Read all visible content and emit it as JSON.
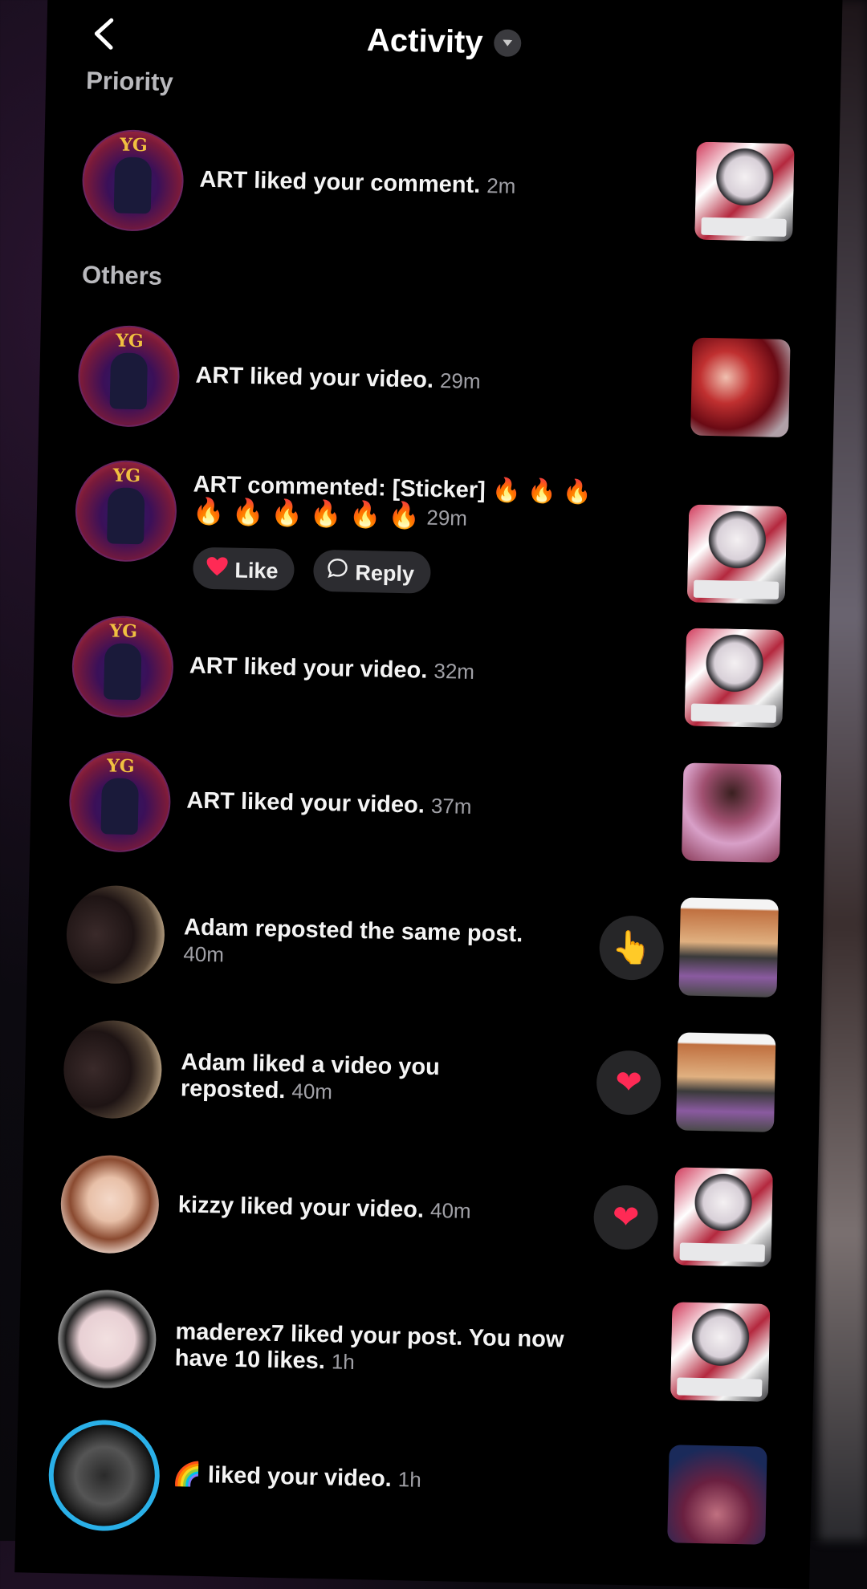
{
  "header": {
    "title": "Activity"
  },
  "sections": {
    "priority": "Priority",
    "others": "Others"
  },
  "avatar_badge": "YG",
  "items": [
    {
      "user": "ART",
      "text": "ART liked your comment.",
      "time": "2m"
    },
    {
      "user": "ART",
      "text": "ART liked your video.",
      "time": "29m"
    },
    {
      "user": "ART",
      "text": "ART commented: [Sticker] 🔥 🔥 🔥",
      "text2": "🔥 🔥 🔥 🔥 🔥 🔥",
      "time": "29m",
      "like_label": "Like",
      "reply_label": "Reply"
    },
    {
      "user": "ART",
      "text": "ART liked your video.",
      "time": "32m"
    },
    {
      "user": "ART",
      "text": "ART liked your video.",
      "time": "37m"
    },
    {
      "user": "Adam",
      "text": "Adam reposted the same post.",
      "time": "40m",
      "action_icon": "pointing-hand-icon",
      "action_glyph": "👆"
    },
    {
      "user": "Adam",
      "text": "Adam liked a video you",
      "text2": "reposted.",
      "time": "40m",
      "action_icon": "heart-icon",
      "action_glyph": "❤"
    },
    {
      "user": "kizzy",
      "text": "kizzy liked your video.",
      "time": "40m",
      "action_icon": "heart-icon",
      "action_glyph": "❤"
    },
    {
      "user": "maderex7",
      "text": "maderex7 liked your post. You now",
      "text2": "have 10 likes.",
      "time": "1h"
    },
    {
      "user": "🌈",
      "text": "🌈 liked your video.",
      "time": "1h"
    }
  ],
  "colors": {
    "background": "#000000",
    "secondary_text": "#a0a0a6",
    "heart": "#ff2a55",
    "story_ring": "#2ab0e8",
    "pill_bg": "#2c2c30"
  }
}
